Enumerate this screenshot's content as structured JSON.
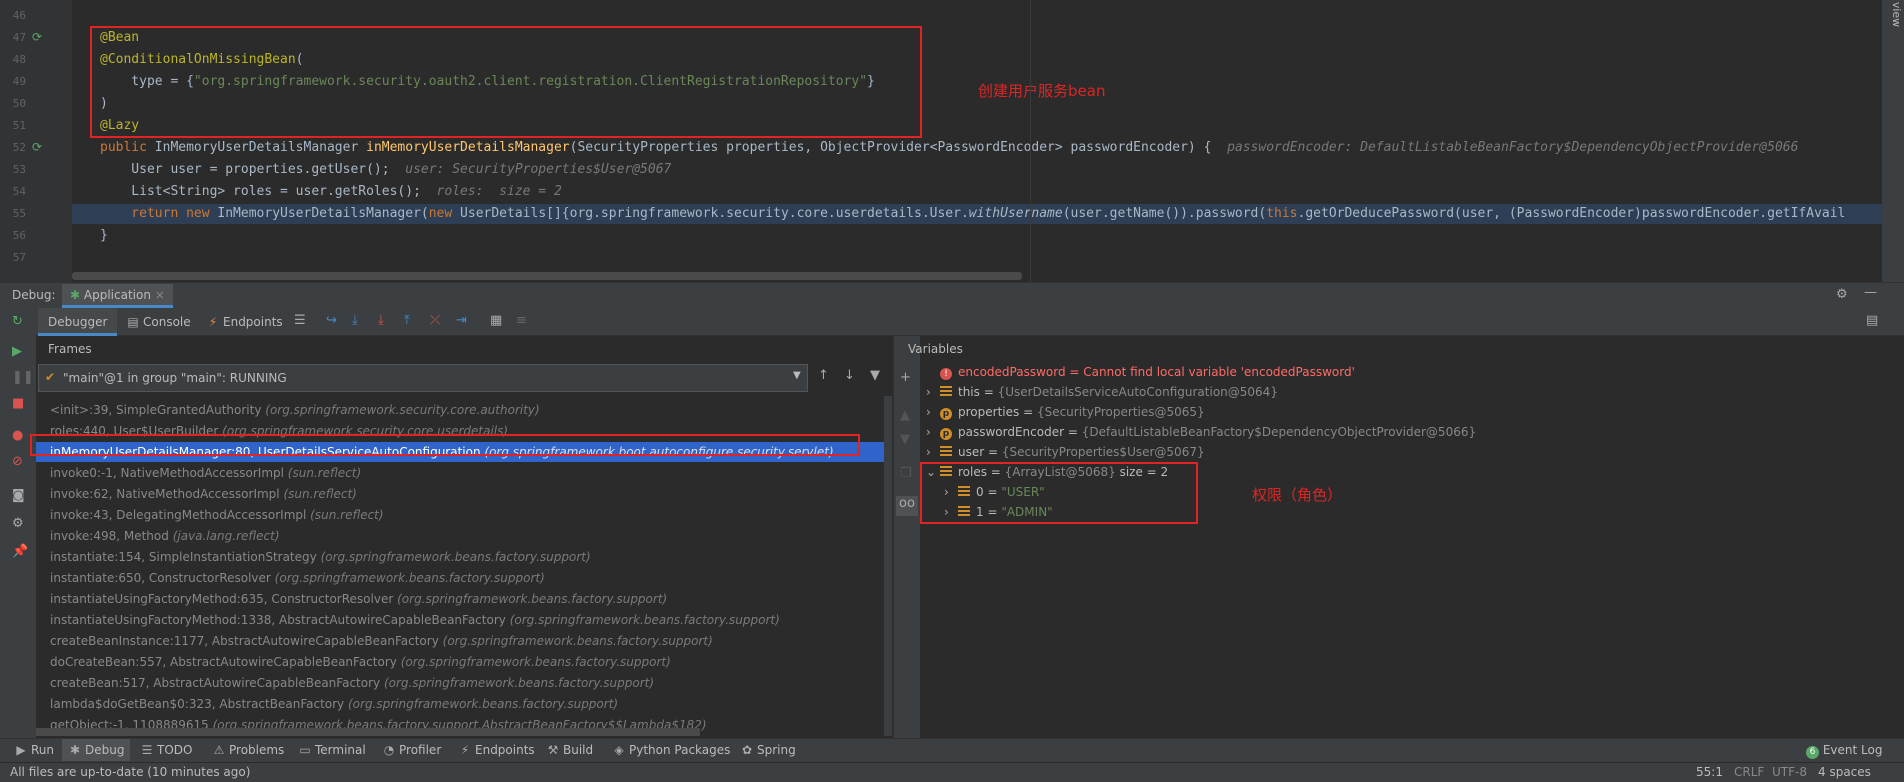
{
  "editor": {
    "lines": [
      {
        "n": "46",
        "parts": []
      },
      {
        "n": "47",
        "parts": [
          {
            "c": "ann",
            "t": "@Bean"
          }
        ]
      },
      {
        "n": "48",
        "parts": [
          {
            "c": "ann",
            "t": "@ConditionalOnMissingBean"
          },
          {
            "c": "",
            "t": "("
          }
        ]
      },
      {
        "n": "49",
        "parts": [
          {
            "c": "",
            "t": "    type = {"
          },
          {
            "c": "str",
            "t": "\"org.springframework.security.oauth2.client.registration.ClientRegistrationRepository\""
          },
          {
            "c": "",
            "t": "}"
          }
        ]
      },
      {
        "n": "50",
        "parts": [
          {
            "c": "",
            "t": ")"
          }
        ]
      },
      {
        "n": "51",
        "parts": [
          {
            "c": "ann",
            "t": "@Lazy"
          }
        ]
      },
      {
        "n": "52",
        "parts": [
          {
            "c": "kw",
            "t": "public "
          },
          {
            "c": "",
            "t": "InMemoryUserDetailsManager "
          },
          {
            "c": "fn",
            "t": "inMemoryUserDetailsManager"
          },
          {
            "c": "",
            "t": "(SecurityProperties properties, ObjectProvider<PasswordEncoder> passwordEncoder) {  "
          },
          {
            "c": "hint",
            "t": "passwordEncoder: DefaultListableBeanFactory$DependencyObjectProvider@5066"
          }
        ]
      },
      {
        "n": "53",
        "parts": [
          {
            "c": "",
            "t": "    User user = properties.getUser();  "
          },
          {
            "c": "hint",
            "t": "user: SecurityProperties$User@5067"
          }
        ]
      },
      {
        "n": "54",
        "parts": [
          {
            "c": "",
            "t": "    List<String> roles = user.getRoles();  "
          },
          {
            "c": "hint",
            "t": "roles:  size = 2"
          }
        ]
      },
      {
        "n": "55",
        "hl": true,
        "parts": [
          {
            "c": "kw",
            "t": "    return new "
          },
          {
            "c": "",
            "t": "InMemoryUserDetailsManager("
          },
          {
            "c": "kw",
            "t": "new "
          },
          {
            "c": "",
            "t": "UserDetails[]{org.springframework.security.core.userdetails.User."
          },
          {
            "c": "it",
            "t": "withUsername"
          },
          {
            "c": "",
            "t": "(user.getName()).password("
          },
          {
            "c": "kw",
            "t": "this"
          },
          {
            "c": "",
            "t": ".getOrDeducePassword(user, (PasswordEncoder)passwordEncoder.getIfAvail"
          }
        ]
      },
      {
        "n": "56",
        "parts": [
          {
            "c": "",
            "t": "}"
          }
        ]
      },
      {
        "n": "57",
        "parts": []
      }
    ],
    "annotation_label": "创建用户服务bean"
  },
  "debug": {
    "title": "Debug:",
    "session_tab": "Application",
    "tabs": [
      "Debugger",
      "Console",
      "Endpoints"
    ],
    "frames_title": "Frames",
    "thread": "\"main\"@1 in group \"main\": RUNNING",
    "frames": [
      {
        "m": "<init>:39, SimpleGrantedAuthority",
        "p": "(org.springframework.security.core.authority)"
      },
      {
        "m": "roles:440, User$UserBuilder",
        "p": "(org.springframework.security.core.userdetails)"
      },
      {
        "m": "inMemoryUserDetailsManager:80, UserDetailsServiceAutoConfiguration",
        "p": "(org.springframework.boot.autoconfigure.security.servlet)",
        "selected": true
      },
      {
        "m": "invoke0:-1, NativeMethodAccessorImpl",
        "p": "(sun.reflect)"
      },
      {
        "m": "invoke:62, NativeMethodAccessorImpl",
        "p": "(sun.reflect)"
      },
      {
        "m": "invoke:43, DelegatingMethodAccessorImpl",
        "p": "(sun.reflect)"
      },
      {
        "m": "invoke:498, Method",
        "p": "(java.lang.reflect)"
      },
      {
        "m": "instantiate:154, SimpleInstantiationStrategy",
        "p": "(org.springframework.beans.factory.support)"
      },
      {
        "m": "instantiate:650, ConstructorResolver",
        "p": "(org.springframework.beans.factory.support)"
      },
      {
        "m": "instantiateUsingFactoryMethod:635, ConstructorResolver",
        "p": "(org.springframework.beans.factory.support)"
      },
      {
        "m": "instantiateUsingFactoryMethod:1338, AbstractAutowireCapableBeanFactory",
        "p": "(org.springframework.beans.factory.support)"
      },
      {
        "m": "createBeanInstance:1177, AbstractAutowireCapableBeanFactory",
        "p": "(org.springframework.beans.factory.support)"
      },
      {
        "m": "doCreateBean:557, AbstractAutowireCapableBeanFactory",
        "p": "(org.springframework.beans.factory.support)"
      },
      {
        "m": "createBean:517, AbstractAutowireCapableBeanFactory",
        "p": "(org.springframework.beans.factory.support)"
      },
      {
        "m": "lambda$doGetBean$0:323, AbstractBeanFactory",
        "p": "(org.springframework.beans.factory.support)"
      },
      {
        "m": "getObject:-1, 1108889615",
        "p": "(org.springframework.beans.factory.support.AbstractBeanFactory$$Lambda$182)"
      }
    ],
    "variables_title": "Variables",
    "variables": [
      {
        "icon": "error",
        "name": "encodedPassword",
        "val": "Cannot find local variable 'encodedPassword'",
        "err": true
      },
      {
        "icon": "field",
        "name": "this",
        "val": "{UserDetailsServiceAutoConfiguration@5064}",
        "exp": ">"
      },
      {
        "icon": "param",
        "name": "properties",
        "val": "{SecurityProperties@5065}",
        "exp": ">"
      },
      {
        "icon": "param",
        "name": "passwordEncoder",
        "val": "{DefaultListableBeanFactory$DependencyObjectProvider@5066}",
        "exp": ">"
      },
      {
        "icon": "field",
        "name": "user",
        "val": "{SecurityProperties$User@5067}",
        "exp": ">"
      },
      {
        "icon": "field",
        "name": "roles",
        "val": "{ArrayList@5068}",
        "extra": "  size = 2",
        "exp": "v"
      },
      {
        "icon": "field",
        "name": "0",
        "val": "\"USER\"",
        "str": true,
        "exp": ">",
        "indent": true
      },
      {
        "icon": "field",
        "name": "1",
        "val": "\"ADMIN\"",
        "str": true,
        "exp": ">",
        "indent": true
      }
    ],
    "roles_label": "权限（角色）"
  },
  "toolwindows": [
    "Run",
    "Debug",
    "TODO",
    "Problems",
    "Terminal",
    "Profiler",
    "Endpoints",
    "Build",
    "Python Packages",
    "Spring"
  ],
  "event_log": "Event Log",
  "event_count": "6",
  "status": {
    "msg": "All files are up-to-date (10 minutes ago)",
    "pos": "55:1",
    "eol": "CRLF",
    "enc": "UTF-8",
    "indent": "4 spaces"
  },
  "side_label": "view"
}
